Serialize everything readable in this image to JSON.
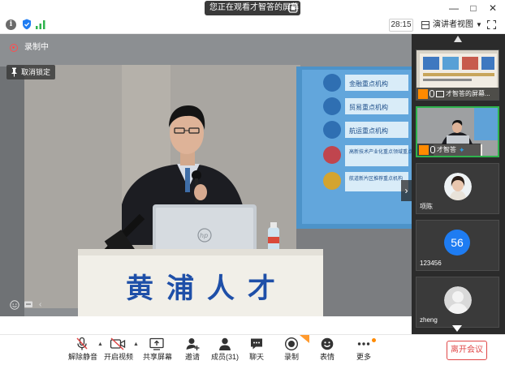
{
  "titlebar": {
    "share_status": "您正在观看才智答的屏幕",
    "minimize": "—",
    "maximize": "□",
    "close": "✕"
  },
  "toolbar": {
    "timer": "28:15",
    "view_mode": "演讲者视图"
  },
  "stage": {
    "recording_label": "录制中",
    "unpin_label": "取消锁定",
    "banner_text": "黄浦人才",
    "board_items": [
      "金融重点机构",
      "贸易重点机构",
      "航运重点机构",
      "高新技术产业化重点领域重点机构",
      "航道新片区推荐重点机构"
    ]
  },
  "panel": {
    "tiles": [
      {
        "name": "才智答的屏幕..."
      },
      {
        "name": "才智答"
      },
      {
        "name": "项陈"
      },
      {
        "name": "123456",
        "avatar_text": "56"
      },
      {
        "name": "zheng"
      }
    ]
  },
  "bottom": {
    "buttons": [
      {
        "label": "解除静音"
      },
      {
        "label": "开启视频"
      },
      {
        "label": "共享屏幕"
      },
      {
        "label": "邀请"
      },
      {
        "label": "成员(31)"
      },
      {
        "label": "聊天"
      },
      {
        "label": "录制"
      },
      {
        "label": "表情"
      },
      {
        "label": "更多"
      }
    ],
    "leave": "离开会议"
  },
  "colors": {
    "accent_green": "#2fb34d",
    "leave_red": "#e04848",
    "avatar_blue": "#1e7cf2",
    "recording_red": "#ff4d4f"
  }
}
